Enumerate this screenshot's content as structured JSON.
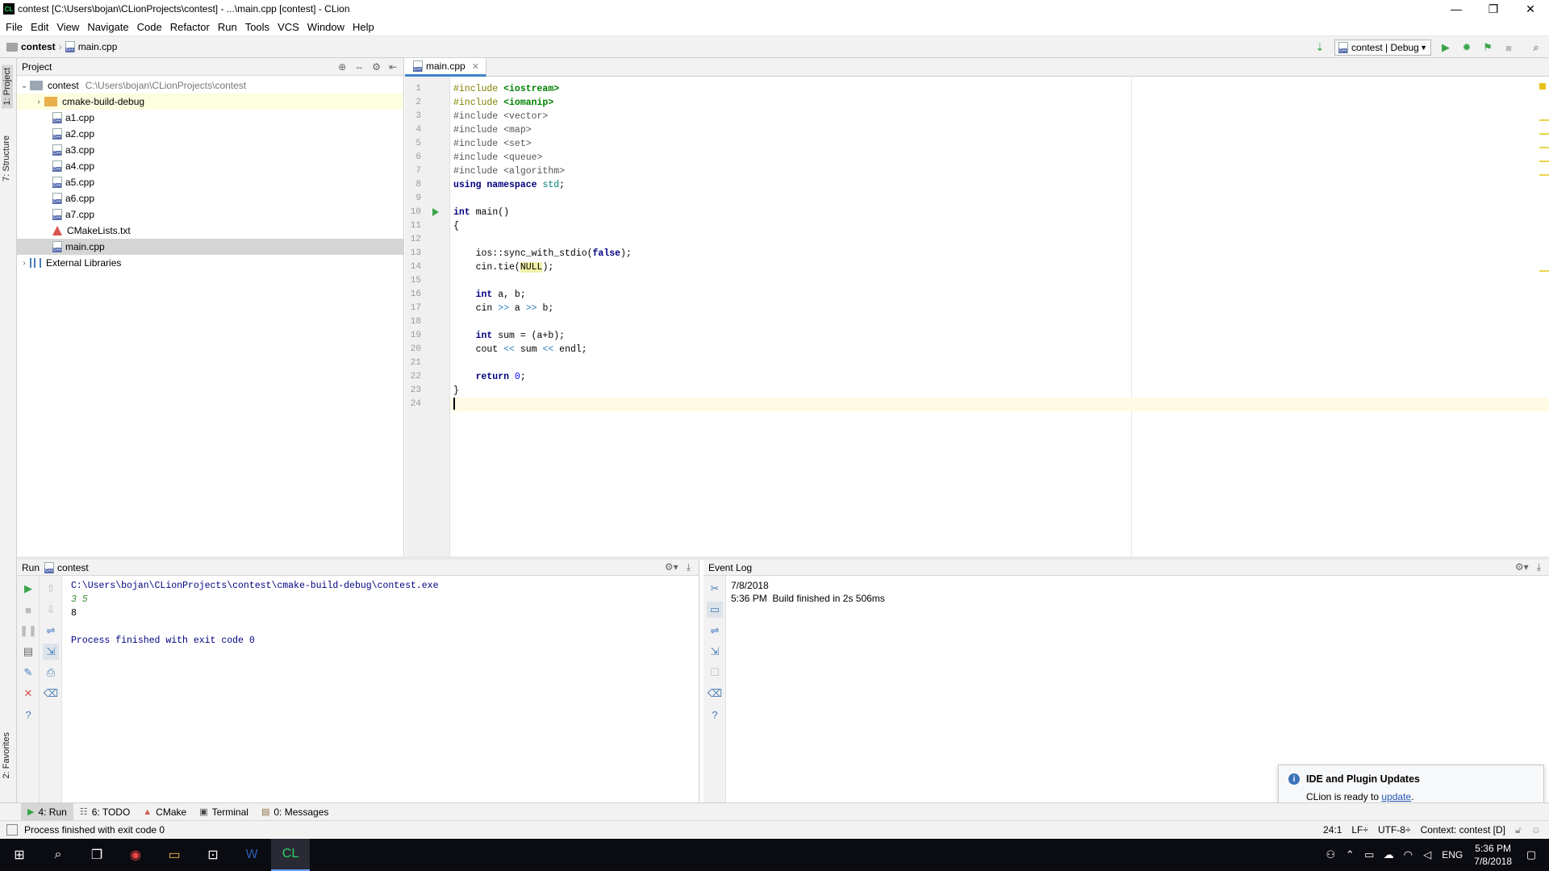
{
  "window": {
    "title": "contest [C:\\Users\\bojan\\CLionProjects\\contest] - ...\\main.cpp [contest] - CLion",
    "minimize": "—",
    "maximize": "❐",
    "close": "✕"
  },
  "menu": [
    "File",
    "Edit",
    "View",
    "Navigate",
    "Code",
    "Refactor",
    "Run",
    "Tools",
    "VCS",
    "Window",
    "Help"
  ],
  "breadcrumb": {
    "project": "contest",
    "file": "main.cpp"
  },
  "run_config": {
    "label": "contest | Debug"
  },
  "left_strip": {
    "project_tab": "1: Project",
    "structure_tab": "7: Structure",
    "favorites_tab": "2: Favorites"
  },
  "project_panel": {
    "title": "Project",
    "root": {
      "name": "contest",
      "path": "C:\\Users\\bojan\\CLionProjects\\contest"
    },
    "build_folder": "cmake-build-debug",
    "files": [
      "a1.cpp",
      "a2.cpp",
      "a3.cpp",
      "a4.cpp",
      "a5.cpp",
      "a6.cpp",
      "a7.cpp"
    ],
    "cmake_file": "CMakeLists.txt",
    "selected_file": "main.cpp",
    "external": "External Libraries"
  },
  "editor": {
    "tab_label": "main.cpp",
    "line_numbers": [
      "1",
      "2",
      "3",
      "4",
      "5",
      "6",
      "7",
      "8",
      "9",
      "10",
      "11",
      "12",
      "13",
      "14",
      "15",
      "16",
      "17",
      "18",
      "19",
      "20",
      "21",
      "22",
      "23",
      "24"
    ],
    "code": {
      "l1_a": "#include",
      "l1_b": "<iostream>",
      "l2_a": "#include",
      "l2_b": "<iomanip>",
      "l3": "#include <vector>",
      "l4": "#include <map>",
      "l5": "#include <set>",
      "l6": "#include <queue>",
      "l7": "#include <algorithm>",
      "l8_a": "using namespace",
      "l8_b": "std",
      "l10_a": "int",
      "l10_b": " main()",
      "l11": "{",
      "l13_a": "    ios::sync_with_stdio(",
      "l13_b": "false",
      "l13_c": ");",
      "l14_a": "    cin.tie(",
      "l14_b": "NULL",
      "l14_c": ");",
      "l16_a": "    int",
      "l16_b": " a, b;",
      "l17_a": "    cin ",
      "l17_b": ">>",
      "l17_c": " a ",
      "l17_d": ">>",
      "l17_e": " b;",
      "l19_a": "    int",
      "l19_b": " sum = (a+b);",
      "l20_a": "    cout ",
      "l20_b": "<<",
      "l20_c": " sum ",
      "l20_d": "<<",
      "l20_e": " endl;",
      "l22_a": "    return",
      "l22_b": "0",
      "l23": "}"
    }
  },
  "run_panel": {
    "label": "Run",
    "config": "contest",
    "console": {
      "command": "C:\\Users\\bojan\\CLionProjects\\contest\\cmake-build-debug\\contest.exe",
      "input": "3 5",
      "output": "8",
      "exit": "Process finished with exit code 0"
    }
  },
  "event_log": {
    "title": "Event Log",
    "date": "7/8/2018",
    "entry_time": "5:36 PM",
    "entry_text": "Build finished in 2s 506ms"
  },
  "notification": {
    "title": "IDE and Plugin Updates",
    "body": "CLion is ready to ",
    "link": "update",
    "tail": "."
  },
  "bottom_tabs": [
    {
      "label": "4: Run",
      "active": true
    },
    {
      "label": "6: TODO",
      "active": false
    },
    {
      "label": "CMake",
      "active": false
    },
    {
      "label": "Terminal",
      "active": false
    },
    {
      "label": "0: Messages",
      "active": false
    }
  ],
  "status_bar": {
    "message": "Process finished with exit code 0",
    "position": "24:1",
    "line_sep": "LF÷",
    "encoding": "UTF-8÷",
    "context": "Context: contest [D]"
  },
  "taskbar": {
    "language": "ENG",
    "time": "5:36 PM",
    "date": "7/8/2018"
  }
}
